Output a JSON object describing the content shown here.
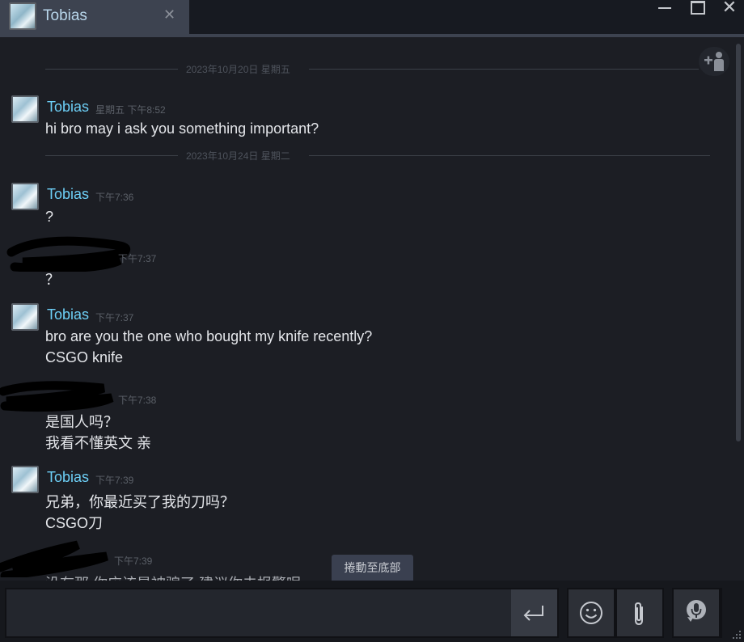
{
  "tab": {
    "name": "Tobias",
    "close_glyph": "✕"
  },
  "window": {
    "min": "—",
    "max": "□",
    "close": "✕"
  },
  "date_separators": [
    "2023年10月20日 星期五",
    "2023年10月24日 星期二"
  ],
  "messages": [
    {
      "sender": "Tobias",
      "time": "星期五 下午8:52",
      "lines": [
        "hi bro may i ask you something important?"
      ]
    },
    {
      "sender": "Tobias",
      "time": "下午7:36",
      "lines": [
        "?"
      ]
    },
    {
      "sender": "",
      "time": "下午7:37",
      "lines": [
        "？"
      ]
    },
    {
      "sender": "Tobias",
      "time": "下午7:37",
      "lines": [
        "bro are you the one who bought my knife recently?",
        "CSGO knife"
      ]
    },
    {
      "sender": "",
      "time": "下午7:38",
      "lines": [
        "是国人吗？",
        "我看不懂英文 亲"
      ]
    },
    {
      "sender": "Tobias",
      "time": "下午7:39",
      "lines": [
        "兄弟，你最近买了我的刀吗？",
        "CSGO刀"
      ]
    },
    {
      "sender": "",
      "time": "下午7:39",
      "lines": [
        "没有那 你应该是被骗了 建议你去报警呢"
      ]
    }
  ],
  "scroll_to_bottom_label": "捲動至底部",
  "composer": {
    "placeholder": "",
    "value": ""
  },
  "icons": {
    "add_friend": "add-friend-icon",
    "send": "enter-arrow-icon",
    "emoji": "smiley-icon",
    "attach": "paperclip-icon",
    "voice": "microphone-icon"
  },
  "colors": {
    "sender_name": "#6dcff6",
    "background": "#1c1e24",
    "tab": "#3d4350"
  }
}
